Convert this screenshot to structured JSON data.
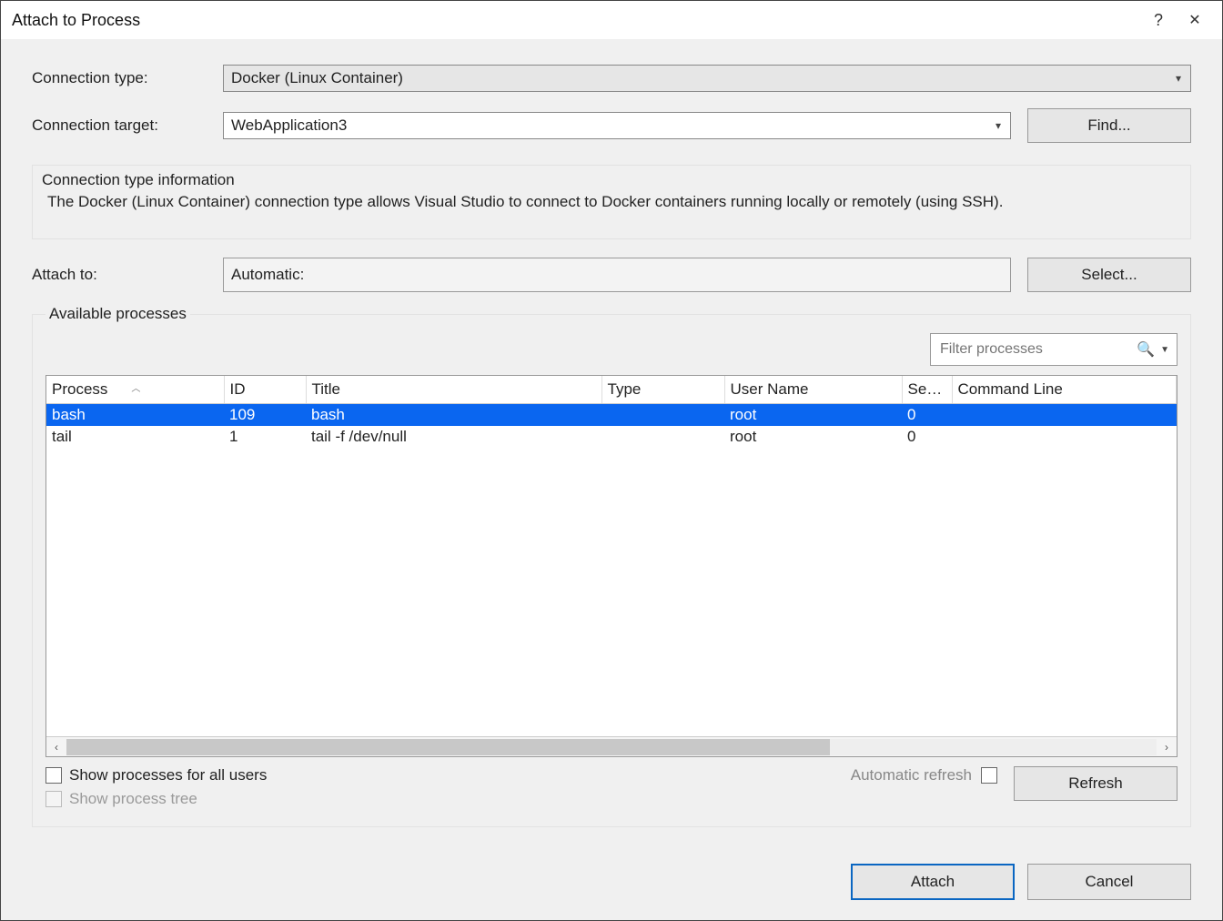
{
  "title": "Attach to Process",
  "labels": {
    "connection_type": "Connection type:",
    "connection_target": "Connection target:",
    "attach_to": "Attach to:",
    "available_processes": "Available processes",
    "conn_info_title": "Connection type information",
    "show_all_users": "Show processes for all users",
    "show_tree": "Show process tree",
    "auto_refresh": "Automatic refresh"
  },
  "fields": {
    "connection_type_value": "Docker (Linux Container)",
    "connection_target_value": "WebApplication3",
    "attach_to_value": "Automatic:",
    "filter_placeholder": "Filter processes"
  },
  "buttons": {
    "find": "Find...",
    "select": "Select...",
    "refresh": "Refresh",
    "attach": "Attach",
    "cancel": "Cancel",
    "help": "?",
    "close": "✕"
  },
  "info_text": "The Docker (Linux Container) connection type allows Visual Studio to connect to Docker containers running locally or remotely (using SSH).",
  "columns": {
    "process": "Process",
    "id": "ID",
    "title": "Title",
    "type": "Type",
    "user": "User Name",
    "sess": "Sess...",
    "cmd": "Command Line"
  },
  "rows": [
    {
      "process": "bash",
      "id": "109",
      "title": "bash",
      "type": "",
      "user": "root",
      "sess": "0",
      "cmd": "",
      "selected": true
    },
    {
      "process": "tail",
      "id": "1",
      "title": "tail -f /dev/null",
      "type": "",
      "user": "root",
      "sess": "0",
      "cmd": "",
      "selected": false
    }
  ]
}
